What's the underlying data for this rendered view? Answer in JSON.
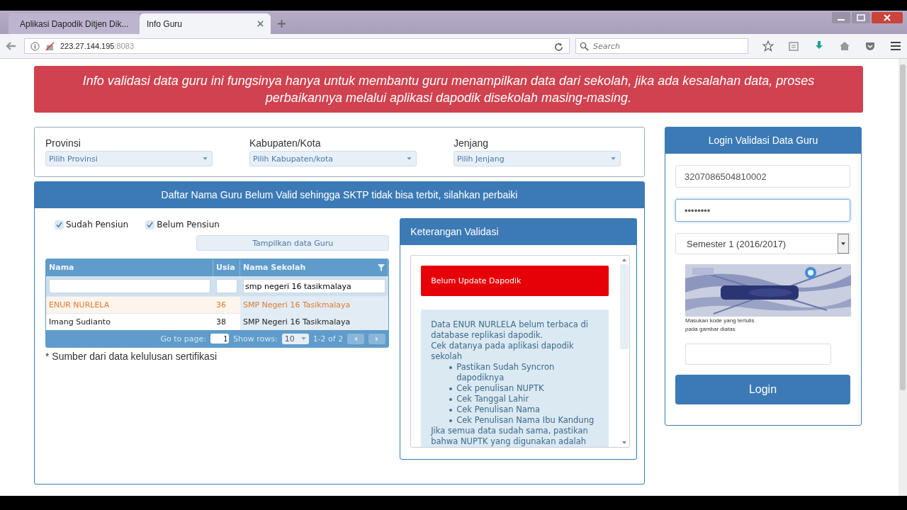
{
  "browser": {
    "tabs": [
      {
        "title": "Aplikasi Dapodik Ditjen Dik...",
        "selected": false
      },
      {
        "title": "Info Guru",
        "selected": true
      }
    ],
    "address": {
      "host": "223.27.144.195",
      "port": ":8083"
    },
    "search": {
      "placeholder": "Search"
    }
  },
  "banner": "Info validasi data guru ini fungsinya hanya untuk membantu guru menampilkan data dari sekolah, jika ada kesalahan data, proses perbaikannya melalui aplikasi dapodik disekolah masing-masing.",
  "filters": [
    {
      "label": "Provinsi",
      "placeholder": "Pilih Provinsi"
    },
    {
      "label": "Kabupaten/Kota",
      "placeholder": "Pilih Kabupaten/kota"
    },
    {
      "label": "Jenjang",
      "placeholder": "Pilih Jenjang"
    }
  ],
  "list_panel": {
    "title": "Daftar Nama Guru Belum Valid sehingga SKTP tidak bisa terbit, silahkan perbaiki",
    "checkboxes": [
      {
        "label": "Sudah Pensiun",
        "checked": true
      },
      {
        "label": "Belum Pensiun",
        "checked": true
      }
    ],
    "show_button": "Tampilkan data Guru",
    "table": {
      "columns": [
        {
          "title": "Nama"
        },
        {
          "title": "Usia"
        },
        {
          "title": "Nama Sekolah",
          "filter": "smp negeri 16 tasikmalaya"
        }
      ],
      "rows": [
        {
          "cells": [
            "ENUR NURLELA",
            "36",
            "SMP Negeri 16 Tasikmalaya"
          ],
          "selected": true
        },
        {
          "cells": [
            "Imang Sudianto",
            "38",
            "SMP Negeri 16 Tasikmalaya"
          ],
          "selected": false
        }
      ],
      "pager": {
        "go_to_label": "Go to page:",
        "page": "1",
        "show_rows_label": "Show rows:",
        "rows_value": "10",
        "range": "1-2 of 2"
      }
    },
    "footnote": "* Sumber dari data kelulusan sertifikasi"
  },
  "keterangan": {
    "title": "Keterangan Validasi",
    "alert": "Belum Update Dapodik",
    "lines": [
      "Data ENUR NURLELA belum terbaca di database replikasi dapodik.",
      "Cek datanya pada aplikasi dapodik sekolah"
    ],
    "bullets": [
      "Pastikan Sudah Syncron dapodiknya",
      "Cek penulisan NUPTK",
      "Cek Tanggal Lahir",
      "Cek Penulisan Nama",
      "Cek Penulisan Nama Ibu Kandung"
    ],
    "after": "Jika semua data sudah sama, pastikan bahwa NUPTK yang digunakan adalah"
  },
  "login": {
    "title": "Login Validasi Data Guru",
    "nik": "3207086504810002",
    "password": "••••••••",
    "semester": "Semester 1 (2016/2017)",
    "captcha_hint": "Masukan kode yang tertulis pada gambar diatas",
    "button": "Login"
  }
}
